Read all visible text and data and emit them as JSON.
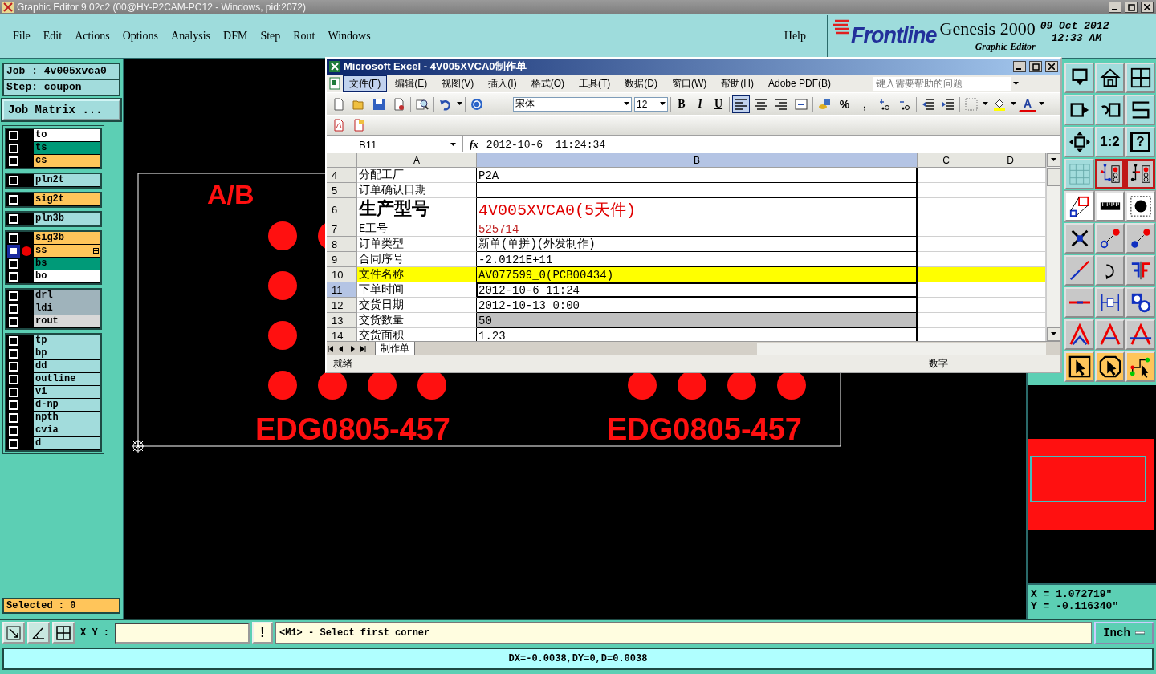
{
  "window": {
    "title": "Graphic Editor 9.02c2 (00@HY-P2CAM-PC12 - Windows, pid:2072)"
  },
  "menu": [
    "File",
    "Edit",
    "Actions",
    "Options",
    "Analysis",
    "DFM",
    "Step",
    "Rout",
    "Windows"
  ],
  "help_menu": "Help",
  "brand": {
    "logo": "Frontline",
    "product": "Genesis 2000",
    "subtitle": "Graphic Editor",
    "date": "09 Oct 2012",
    "time": "12:33 AM"
  },
  "job": {
    "job": "Job : 4v005xvca0",
    "step": "Step: coupon",
    "matrix_button": "Job Matrix ..."
  },
  "layer_groups": [
    [
      {
        "name": "to",
        "color": "#ffffff",
        "checked": false,
        "selected": false
      },
      {
        "name": "ts",
        "color": "#009a78",
        "checked": false,
        "selected": false
      },
      {
        "name": "cs",
        "color": "#ffc55a",
        "checked": false,
        "selected": false
      }
    ],
    [
      {
        "name": "pln2t",
        "color": "#a2dcdc",
        "checked": false,
        "selected": false
      }
    ],
    [
      {
        "name": "sig2t",
        "color": "#ffc55a",
        "checked": false,
        "selected": false
      }
    ],
    [
      {
        "name": "pln3b",
        "color": "#a2dcdc",
        "checked": false,
        "selected": false
      }
    ],
    [
      {
        "name": "sig3b",
        "color": "#ffc55a",
        "checked": false,
        "selected": false
      },
      {
        "name": "ss",
        "color": "#ffc55a",
        "checked": false,
        "selected": true
      },
      {
        "name": "bs",
        "color": "#009a78",
        "checked": false,
        "selected": false
      },
      {
        "name": "bo",
        "color": "#ffffff",
        "checked": false,
        "selected": false
      }
    ],
    [
      {
        "name": "drl",
        "color": "#9fb3bb",
        "checked": false,
        "selected": false
      },
      {
        "name": "ldi",
        "color": "#9fb3bb",
        "checked": false,
        "selected": false
      },
      {
        "name": "rout",
        "color": "#d8d8d8",
        "checked": false,
        "selected": false
      }
    ],
    [
      {
        "name": "tp",
        "color": "#a2dcdc",
        "checked": false,
        "selected": false
      },
      {
        "name": "bp",
        "color": "#a2dcdc",
        "checked": false,
        "selected": false
      },
      {
        "name": "dd",
        "color": "#a2dcdc",
        "checked": false,
        "selected": false
      },
      {
        "name": "outline",
        "color": "#a2dcdc",
        "checked": false,
        "selected": false
      },
      {
        "name": "vi",
        "color": "#a2dcdc",
        "checked": false,
        "selected": false
      },
      {
        "name": "d-np",
        "color": "#a2dcdc",
        "checked": false,
        "selected": false
      },
      {
        "name": "npth",
        "color": "#a2dcdc",
        "checked": false,
        "selected": false
      },
      {
        "name": "cvia",
        "color": "#a2dcdc",
        "checked": false,
        "selected": false
      },
      {
        "name": "d",
        "color": "#a2dcdc",
        "checked": false,
        "selected": false
      }
    ]
  ],
  "selected_count": "Selected : 0",
  "canvas": {
    "mark": "A/B",
    "labels": [
      "EDG0805-457",
      "EDG0805-457"
    ]
  },
  "right_toolbar": {
    "scale": "1:2",
    "help": "?"
  },
  "coordinates": {
    "x": "X = 1.072719\"",
    "y": "Y = -0.116340\""
  },
  "command_bar": {
    "xy_label": "X Y :",
    "alert": "!",
    "message": "<M1> - Select first corner",
    "units": "Inch"
  },
  "status_bar": "DX=-0.0038,DY=0,D=0.0038",
  "excel": {
    "title": "Microsoft Excel - 4V005XVCA0制作单",
    "menu": [
      {
        "label": "文件(F)",
        "selected": true
      },
      {
        "label": "编辑(E)",
        "selected": false
      },
      {
        "label": "视图(V)",
        "selected": false
      },
      {
        "label": "插入(I)",
        "selected": false
      },
      {
        "label": "格式(O)",
        "selected": false
      },
      {
        "label": "工具(T)",
        "selected": false
      },
      {
        "label": "数据(D)",
        "selected": false
      },
      {
        "label": "窗口(W)",
        "selected": false
      },
      {
        "label": "帮助(H)",
        "selected": false
      },
      {
        "label": "Adobe PDF(B)",
        "selected": false
      }
    ],
    "help_placeholder": "键入需要帮助的问题",
    "font": "宋体",
    "font_size": "12",
    "format_buttons": [
      "B",
      "I",
      "U"
    ],
    "percent": "%",
    "comma": ",",
    "font_color": "A",
    "name_box": "B11",
    "function_label": "fx",
    "formula": "2012-10-6  11:24:34",
    "columns": [
      {
        "label": "A",
        "selected": false
      },
      {
        "label": "B",
        "selected": true
      },
      {
        "label": "C",
        "selected": false
      },
      {
        "label": "D",
        "selected": false
      }
    ],
    "rows": [
      {
        "number": "4",
        "a": "分配工厂",
        "b": "P2A",
        "kind": "plain",
        "selected": false
      },
      {
        "number": "5",
        "a": "订单确认日期",
        "kind": "plain",
        "selected": false
      },
      {
        "number": "6",
        "a": "生产型号",
        "b": "4V005XVCA0(5天件)",
        "kind": "heading",
        "selected": false
      },
      {
        "number": "7",
        "a": "E工号",
        "b": "525714",
        "kind": "red",
        "selected": false
      },
      {
        "number": "8",
        "a": "订单类型",
        "b": "新单(单拼)(外发制作)",
        "kind": "plain",
        "selected": false
      },
      {
        "number": "9",
        "a": "合同序号",
        "b": "-2.0121E+11",
        "kind": "plain",
        "selected": false
      },
      {
        "number": "10",
        "a": "文件名称",
        "b": "AV077599_0(PCB00434)",
        "kind": "highlight",
        "selected": false
      },
      {
        "number": "11",
        "a": "下单时间",
        "b": "2012-10-6 11:24",
        "kind": "plain",
        "selected": true
      },
      {
        "number": "12",
        "a": "交货日期",
        "b": "2012-10-13 0:00",
        "kind": "plain",
        "selected": false
      },
      {
        "number": "13",
        "a": "交货数量",
        "b": "50",
        "kind": "shaded",
        "selected": false
      },
      {
        "number": "14",
        "a": "交货面积",
        "b": "1.23",
        "kind": "plain",
        "selected": false
      }
    ],
    "sheet_tab": "制作单",
    "status": "就绪",
    "mode": "数字"
  }
}
